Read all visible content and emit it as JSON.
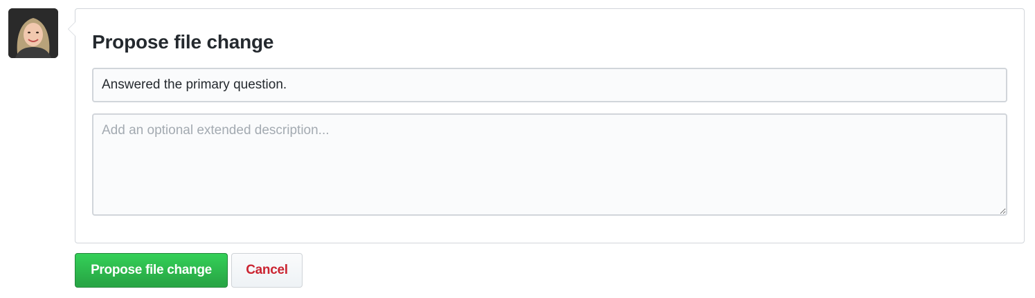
{
  "avatar": {
    "icon": "user-avatar"
  },
  "form": {
    "title": "Propose file change",
    "summary_value": "Answered the primary question.",
    "description_placeholder": "Add an optional extended description...",
    "description_value": ""
  },
  "actions": {
    "submit_label": "Propose file change",
    "cancel_label": "Cancel"
  },
  "colors": {
    "primary_green": "#28a745",
    "cancel_red": "#cb2431",
    "border": "#d1d5da"
  }
}
